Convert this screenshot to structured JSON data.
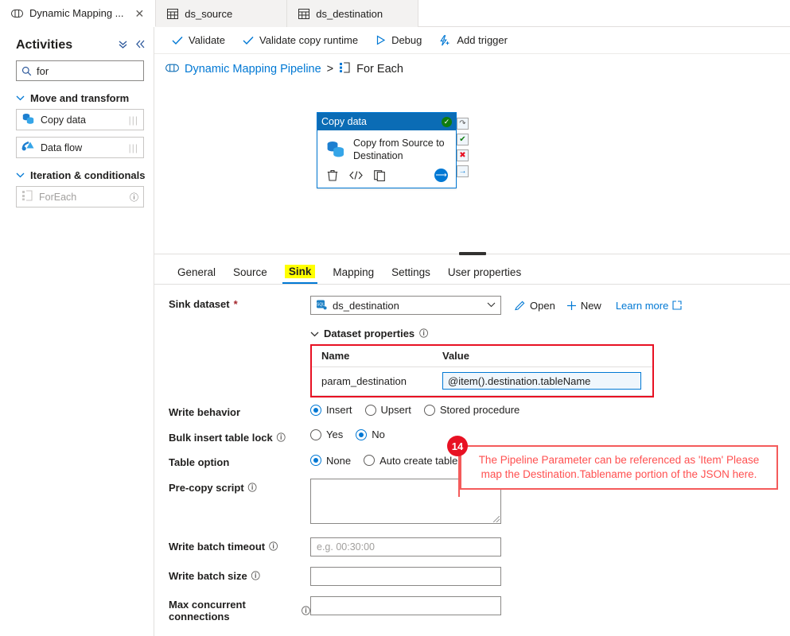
{
  "tabs": [
    {
      "label": "Dynamic Mapping ...",
      "icon": "pipeline-icon",
      "active": true,
      "closable": true
    },
    {
      "label": "ds_source",
      "icon": "dataset-table-icon",
      "active": false,
      "closable": false
    },
    {
      "label": "ds_destination",
      "icon": "dataset-table-icon",
      "active": false,
      "closable": false
    }
  ],
  "sidebar": {
    "title": "Activities",
    "collapse_all_icon": "double-chevron-down-icon",
    "collapse_panel_icon": "double-chevron-left-icon",
    "search": {
      "value": "for",
      "placeholder": "Search activities",
      "icon": "search-icon"
    },
    "groups": [
      {
        "label": "Move and transform",
        "items": [
          {
            "label": "Copy data",
            "icon": "copy-data-icon",
            "disabled": false
          },
          {
            "label": "Data flow",
            "icon": "data-flow-icon",
            "disabled": false
          }
        ]
      },
      {
        "label": "Iteration & conditionals",
        "items": [
          {
            "label": "ForEach",
            "icon": "foreach-icon",
            "disabled": true,
            "info": "ⓘ"
          }
        ]
      }
    ]
  },
  "toolbar": {
    "validate": "Validate",
    "validate_copy_runtime": "Validate copy runtime",
    "debug": "Debug",
    "add_trigger": "Add trigger"
  },
  "breadcrumb": {
    "root": "Dynamic Mapping Pipeline",
    "separator": ">",
    "current": "For Each",
    "root_icon": "pipeline-icon",
    "current_icon": "foreach-icon"
  },
  "canvas": {
    "node": {
      "title": "Copy data",
      "status_icon": "check-circle-green-icon",
      "name": "Copy from Source to Destination",
      "type_icon": "copy-data-icon",
      "actions": [
        {
          "name": "delete-icon",
          "glyph": "🗑"
        },
        {
          "name": "code-icon",
          "glyph": "</>"
        },
        {
          "name": "clone-icon",
          "glyph": "❐"
        }
      ],
      "add_output_icon": "arrow-right-circle-icon",
      "connectors": [
        {
          "name": "skipped-connector-icon",
          "glyph": "↷",
          "color": "#5b5b5b"
        },
        {
          "name": "success-connector-icon",
          "glyph": "✔",
          "color": "#107c10"
        },
        {
          "name": "failure-connector-icon",
          "glyph": "✖",
          "color": "#e81123"
        },
        {
          "name": "completion-connector-icon",
          "glyph": "→",
          "color": "#0078d4"
        }
      ]
    }
  },
  "property_tabs": [
    {
      "label": "General",
      "selected": false,
      "highlighted": false
    },
    {
      "label": "Source",
      "selected": false,
      "highlighted": false
    },
    {
      "label": "Sink",
      "selected": true,
      "highlighted": true
    },
    {
      "label": "Mapping",
      "selected": false,
      "highlighted": false
    },
    {
      "label": "Settings",
      "selected": false,
      "highlighted": false
    },
    {
      "label": "User properties",
      "selected": false,
      "highlighted": false
    }
  ],
  "sink": {
    "dataset_label": "Sink dataset",
    "dataset_required_marker": "*",
    "dataset_value": "ds_destination",
    "dataset_icon": "sql-dataset-icon",
    "caret_icon": "chevron-down-icon",
    "open_label": "Open",
    "open_icon": "pencil-icon",
    "new_label": "New",
    "new_icon": "plus-icon",
    "learn_more_label": "Learn more",
    "learn_more_icon": "external-link-icon",
    "dataset_properties_label": "Dataset properties",
    "dataset_properties_info_icon": "info-icon",
    "dataset_properties_chevron": "chevron-down-icon",
    "properties_table": {
      "columns": [
        "Name",
        "Value"
      ],
      "rows": [
        {
          "name": "param_destination",
          "value": "@item().destination.tableName"
        }
      ]
    },
    "write_behavior": {
      "label": "Write behavior",
      "options": [
        {
          "label": "Insert",
          "selected": true
        },
        {
          "label": "Upsert",
          "selected": false
        },
        {
          "label": "Stored procedure",
          "selected": false
        }
      ]
    },
    "bulk_insert_table_lock": {
      "label": "Bulk insert table lock",
      "info_icon": "info-icon",
      "options": [
        {
          "label": "Yes",
          "selected": false
        },
        {
          "label": "No",
          "selected": true
        }
      ]
    },
    "table_option": {
      "label": "Table option",
      "options": [
        {
          "label": "None",
          "selected": true,
          "info_icon": null
        },
        {
          "label": "Auto create table",
          "selected": false,
          "info_icon": "info-icon"
        }
      ]
    },
    "pre_copy_script": {
      "label": "Pre-copy script",
      "info_icon": "info-icon",
      "value": "",
      "placeholder": ""
    },
    "write_batch_timeout": {
      "label": "Write batch timeout",
      "info_icon": "info-icon",
      "value": "",
      "placeholder": "e.g. 00:30:00"
    },
    "write_batch_size": {
      "label": "Write batch size",
      "info_icon": "info-icon",
      "value": "",
      "placeholder": ""
    },
    "max_concurrent_connections": {
      "label": "Max concurrent connections",
      "info_icon": "info-icon",
      "value": "",
      "placeholder": ""
    }
  },
  "annotation": {
    "step_number": "14",
    "text": "The Pipeline Parameter can be referenced as 'Item' Please map the Destination.Tablename portion of the JSON here."
  },
  "colors": {
    "accent": "#0078d4",
    "highlight": "#ffff00",
    "annotation_red": "#ff5050",
    "callout_border": "#f45b5b",
    "badge_red": "#e81123",
    "success_green": "#107c10",
    "required_red": "#a4262c"
  }
}
